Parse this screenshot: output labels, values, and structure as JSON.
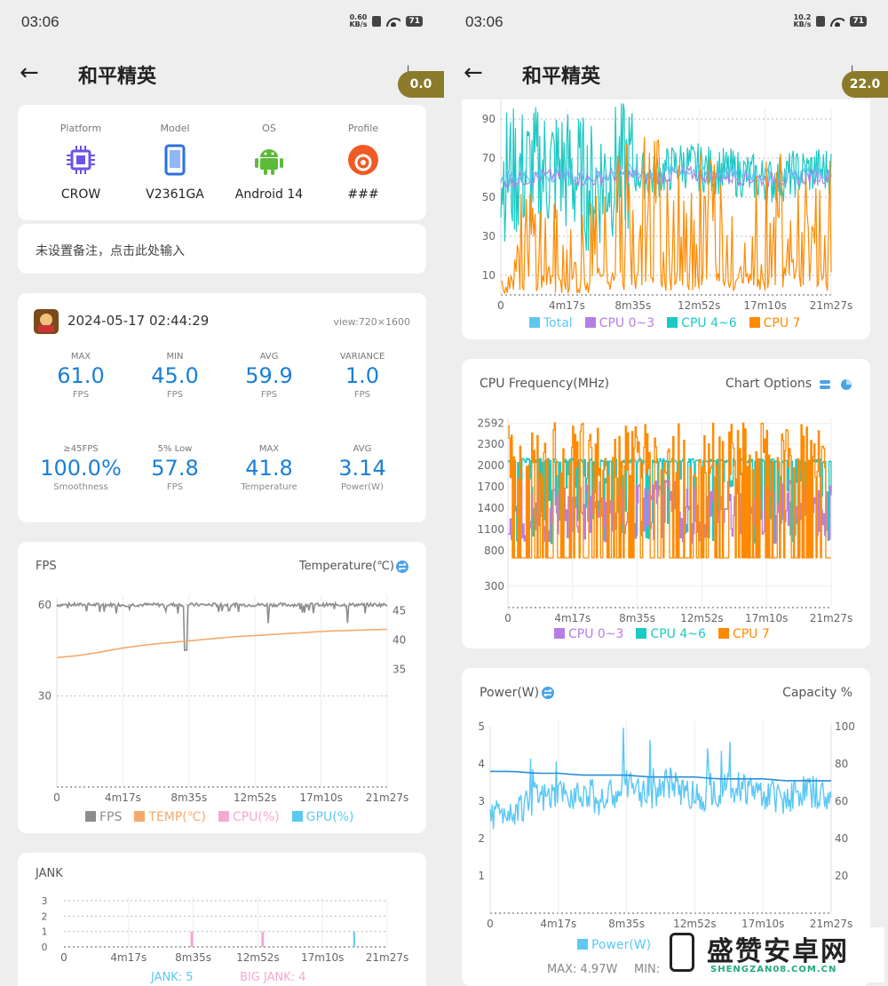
{
  "colors": {
    "blue_value": "#1a7fd6",
    "pill": "#8a7a2a",
    "total": "#5cc8f0",
    "cpu03": "#b57ee6",
    "cpu46": "#1cc9c4",
    "cpu7": "#ff8a00",
    "fps": "#8d8d8d",
    "temp": "#f4aa6e",
    "cpu_pct": "#f5a8d2",
    "gpu_pct": "#5cc8f0",
    "power": "#5bc8f5"
  },
  "left": {
    "status": {
      "time": "03:06",
      "net_speed_value": "0.60",
      "net_speed_unit": "KB/s",
      "battery": "71"
    },
    "header": {
      "title": "和平精英",
      "pill_value": "0.0"
    },
    "device": [
      {
        "label": "Platform",
        "value": "CROW",
        "icon": "chip-icon"
      },
      {
        "label": "Model",
        "value": "V2361GA",
        "icon": "phone-icon"
      },
      {
        "label": "OS",
        "value": "Android 14",
        "icon": "android-icon"
      },
      {
        "label": "Profile",
        "value": "###",
        "icon": "profile-icon"
      }
    ],
    "note_placeholder": "未设置备注，点击此处输入",
    "session": {
      "datetime": "2024-05-17 02:44:29",
      "view": "view:720×1600"
    },
    "stats": [
      {
        "label": "MAX",
        "value": "61.0",
        "unit": "FPS"
      },
      {
        "label": "MIN",
        "value": "45.0",
        "unit": "FPS"
      },
      {
        "label": "AVG",
        "value": "59.9",
        "unit": "FPS"
      },
      {
        "label": "VARIANCE",
        "value": "1.0",
        "unit": "FPS"
      },
      {
        "label": "≥45FPS",
        "value": "100.0%",
        "unit": "Smoothness"
      },
      {
        "label": "5% Low",
        "value": "57.8",
        "unit": "FPS"
      },
      {
        "label": "MAX",
        "value": "41.8",
        "unit": "Temperature"
      },
      {
        "label": "AVG",
        "value": "3.14",
        "unit": "Power(W)"
      }
    ],
    "fps_card": {
      "title": "FPS",
      "right_title": "Temperature(℃)",
      "legend": [
        "FPS",
        "TEMP(℃)",
        "CPU(%)",
        "GPU(%)"
      ]
    },
    "jank_card": {
      "title": "JANK",
      "jank": "JANK: 5",
      "big_jank": "BIG JANK: 4"
    }
  },
  "right": {
    "status": {
      "time": "03:06",
      "net_speed_value": "10.2",
      "net_speed_unit": "KB/s",
      "battery": "71"
    },
    "header": {
      "title": "和平精英",
      "pill_value": "22.0"
    },
    "cpu_usage_card": {
      "legend": [
        "Total",
        "CPU 0~3",
        "CPU 4~6",
        "CPU 7"
      ]
    },
    "cpu_freq_card": {
      "title": "CPU Frequency(MHz)",
      "options": "Chart Options",
      "legend": [
        "CPU 0~3",
        "CPU 4~6",
        "CPU 7"
      ]
    },
    "power_card": {
      "title": "Power(W)",
      "right_title": "Capacity %",
      "legend": [
        "Power(W)"
      ],
      "max": "MAX: 4.97W",
      "min": "MIN:"
    },
    "watermark": {
      "main": "盛赞安卓网",
      "sub": "SHENGZAN08.COM.CN"
    }
  },
  "chart_data": [
    {
      "type": "line",
      "title": "FPS",
      "x_ticks": [
        "0",
        "4m17s",
        "8m35s",
        "12m52s",
        "17m10s",
        "21m27s"
      ],
      "y_ticks": [
        "60",
        "30"
      ],
      "y2_ticks": [
        "45",
        "40",
        "35"
      ],
      "series": [
        {
          "name": "FPS",
          "values": [
            60,
            60,
            60,
            59,
            60,
            60,
            45,
            60,
            60,
            60,
            58,
            60,
            60,
            60,
            59,
            60,
            60,
            60
          ]
        },
        {
          "name": "TEMP(℃)",
          "values": [
            37,
            37.3,
            37.8,
            38.4,
            38.9,
            39.3,
            39.6,
            39.9,
            40.2,
            40.5,
            40.7,
            40.9,
            41.1,
            41.3,
            41.5,
            41.6,
            41.7,
            41.8
          ]
        }
      ]
    },
    {
      "type": "bar",
      "title": "JANK",
      "x_ticks": [
        "0",
        "4m17s",
        "8m35s",
        "12m52s",
        "17m10s",
        "21m27s"
      ],
      "y_ticks": [
        "3",
        "2",
        "1",
        "0"
      ],
      "series": [
        {
          "name": "JANK",
          "points": [
            [
              8.4,
              1
            ],
            [
              13.1,
              1
            ]
          ]
        },
        {
          "name": "BIG JANK",
          "points": [
            [
              19.2,
              1
            ]
          ]
        }
      ]
    },
    {
      "type": "line",
      "title": "CPU usage",
      "x_ticks": [
        "0",
        "4m17s",
        "8m35s",
        "12m52s",
        "17m10s",
        "21m27s"
      ],
      "y_ticks": [
        "90",
        "70",
        "50",
        "30",
        "10"
      ],
      "series": [
        {
          "name": "Total",
          "values": [
            60,
            61,
            62,
            60,
            63,
            62,
            64,
            63,
            62,
            61,
            62,
            63
          ]
        },
        {
          "name": "CPU 0~3",
          "values": [
            58,
            60,
            61,
            59,
            62,
            60,
            62,
            61,
            60,
            59,
            60,
            61
          ]
        },
        {
          "name": "CPU 4~6",
          "values": [
            62,
            63,
            65,
            55,
            66,
            60,
            67,
            64,
            62,
            58,
            63,
            64
          ]
        },
        {
          "name": "CPU 7",
          "values": [
            10,
            30,
            15,
            20,
            45,
            60,
            35,
            50,
            25,
            55,
            30,
            40
          ]
        }
      ]
    },
    {
      "type": "line",
      "title": "CPU Frequency(MHz)",
      "x_ticks": [
        "0",
        "4m17s",
        "8m35s",
        "12m52s",
        "17m10s",
        "21m27s"
      ],
      "y_ticks": [
        "2592",
        "2300",
        "2000",
        "1700",
        "1400",
        "1100",
        "800",
        "300"
      ],
      "series": [
        {
          "name": "CPU 0~3",
          "values": [
            1100,
            1000,
            1300,
            1200,
            1500,
            1100,
            1200,
            1000,
            1300,
            1200
          ]
        },
        {
          "name": "CPU 4~6",
          "values": [
            2100,
            2100,
            2100,
            2050,
            2100,
            2050,
            2050,
            2050,
            2050,
            2050
          ]
        },
        {
          "name": "CPU 7",
          "values": [
            700,
            2500,
            800,
            700,
            2400,
            800,
            2300,
            700,
            2400,
            800
          ]
        }
      ]
    },
    {
      "type": "line",
      "title": "Power(W)",
      "x_ticks": [
        "0",
        "4m17s",
        "8m35s",
        "12m52s",
        "17m10s",
        "21m27s"
      ],
      "y_ticks": [
        "5",
        "4",
        "3",
        "2",
        "1"
      ],
      "y2_ticks": [
        "100",
        "80",
        "60",
        "40",
        "20"
      ],
      "series": [
        {
          "name": "Power(W)",
          "values": [
            2.6,
            2.8,
            3.0,
            3.1,
            3.3,
            3.0,
            3.4,
            3.2,
            3.5,
            3.1,
            3.3,
            3.4,
            3.2,
            3.1,
            3.3,
            3.0
          ]
        },
        {
          "name": "Capacity %",
          "values": [
            76,
            76,
            75,
            75,
            74,
            74,
            74,
            73,
            73,
            73,
            72,
            72,
            72,
            71,
            71,
            71
          ]
        }
      ]
    }
  ]
}
